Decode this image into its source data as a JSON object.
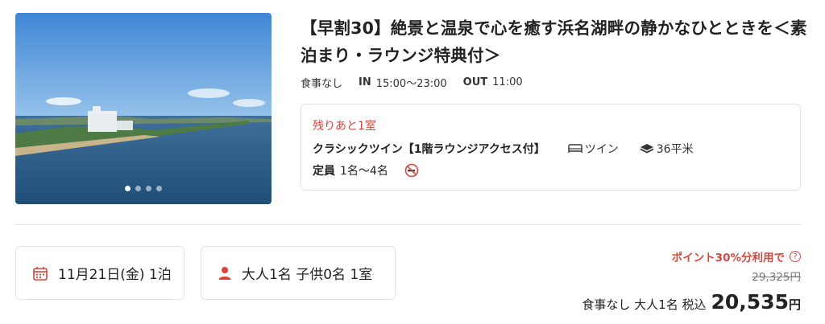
{
  "plan": {
    "title": "【早割30】絶景と温泉で心を癒す浜名湖畔の静かなひとときを＜素泊まり・ラウンジ特典付＞",
    "meal": "食事なし",
    "checkin_label": "IN",
    "checkin_time": "15:00〜23:00",
    "checkout_label": "OUT",
    "checkout_time": "11:00",
    "photo_dots": 4,
    "photo_active_dot": 1
  },
  "room": {
    "remaining": "残りあと1室",
    "name": "クラシックツイン【1階ラウンジアクセス付】",
    "bed": "ツイン",
    "size": "36平米",
    "capacity_label": "定員",
    "capacity": "1名〜4名",
    "nonsmoking_icon": "no-smoking-icon"
  },
  "search": {
    "date": "11月21日(金) 1泊",
    "guests": "大人1名 子供0名 1室"
  },
  "price": {
    "point_note": "ポイント30%分利用で",
    "original": "29,325円",
    "label": "食事なし 大人1名 税込",
    "amount": "20,535",
    "currency": "円"
  },
  "colors": {
    "accent": "#d9463c",
    "border": "#e3e3e3"
  }
}
